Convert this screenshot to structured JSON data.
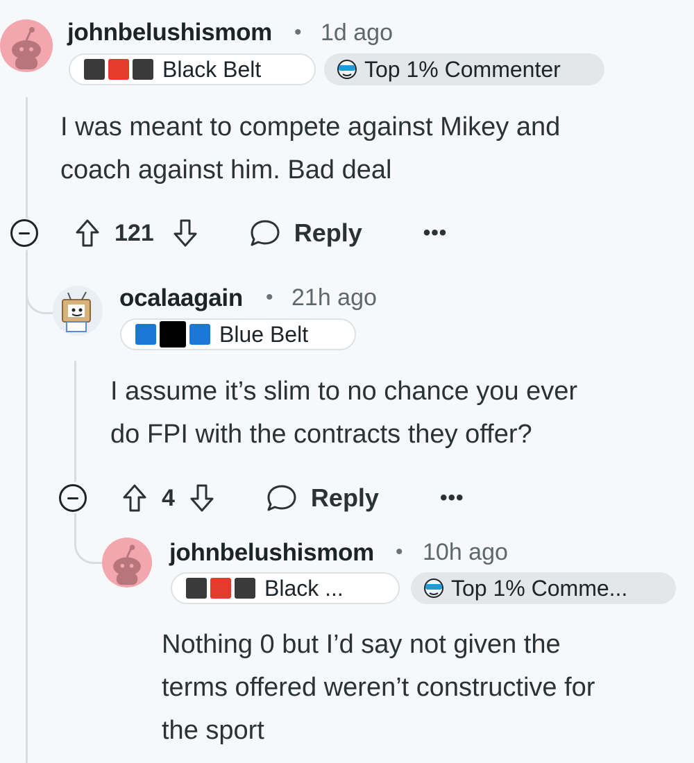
{
  "comments": [
    {
      "username": "johnbelushismom",
      "time": "1d ago",
      "flair": "Black Belt",
      "badge": "Top 1% Commenter",
      "body_line1": "I was meant to compete against Mikey and",
      "body_line2": "coach against him. Bad deal",
      "votes": "121",
      "reply_label": "Reply",
      "more_label": "•••"
    },
    {
      "username": "ocalaagain",
      "time": "21h ago",
      "flair": "Blue Belt",
      "body_line1": "I assume it’s slim to no chance you ever",
      "body_line2": "do FPI with the contracts they offer?",
      "votes": "4",
      "reply_label": "Reply",
      "more_label": "•••"
    },
    {
      "username": "johnbelushismom",
      "time": "10h ago",
      "flair": "Black ...",
      "badge": "Top 1% Comme...",
      "body_line1": "Nothing 0 but I’d say not given the",
      "body_line2": "terms offered weren’t constructive for",
      "body_line3": "the sport"
    }
  ],
  "separator": "•",
  "colors": {
    "avatar_pink": "#f4a6ae",
    "belt_red": "#e53b2c",
    "belt_blue": "#1b78d6",
    "thread_line": "#d8dcdf"
  },
  "icons": [
    "snoo-avatar-icon",
    "tv-avatar-icon",
    "sunglasses-badge-icon",
    "upvote-icon",
    "downvote-icon",
    "reply-bubble-icon",
    "collapse-icon",
    "more-options-icon"
  ]
}
